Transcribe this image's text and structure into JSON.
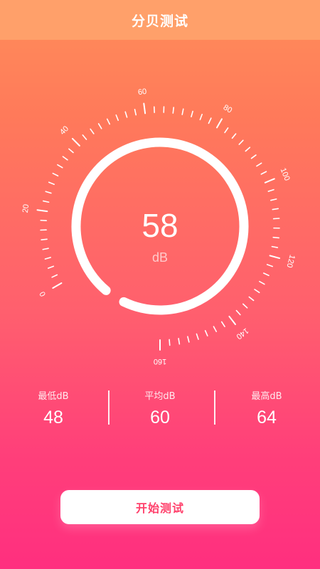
{
  "header": {
    "title": "分贝测试"
  },
  "gauge": {
    "value": "58",
    "unit": "dB",
    "scale_min": 0,
    "scale_max": 160,
    "scale_labels": [
      "0",
      "20",
      "40",
      "60",
      "80",
      "100",
      "120",
      "140",
      "160"
    ],
    "level_fraction": 0.96
  },
  "stats": {
    "min_label": "最低dB",
    "min_value": "48",
    "avg_label": "平均dB",
    "avg_value": "60",
    "max_label": "最高dB",
    "max_value": "64"
  },
  "actions": {
    "start_label": "开始测试"
  },
  "colors": {
    "accent": "#ff3f6a",
    "header_bg": "#ffa06a"
  }
}
